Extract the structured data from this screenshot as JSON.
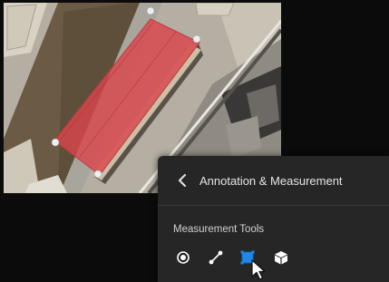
{
  "panel": {
    "title": "Annotation & Measurement",
    "back_icon": "chevron-left-icon",
    "section_label": "Measurement Tools",
    "tools": [
      {
        "name": "point-measure",
        "icon": "point-target-icon",
        "active": false
      },
      {
        "name": "distance-measure",
        "icon": "line-distance-icon",
        "active": false
      },
      {
        "name": "area-measure",
        "icon": "area-square-icon",
        "active": true
      },
      {
        "name": "volume-measure",
        "icon": "volume-cube-icon",
        "active": false
      }
    ]
  },
  "colors": {
    "panel_bg": "#262626",
    "text": "#e6e6e6",
    "accent": "#1e88e5",
    "polygon_fill": "#d9464c"
  }
}
